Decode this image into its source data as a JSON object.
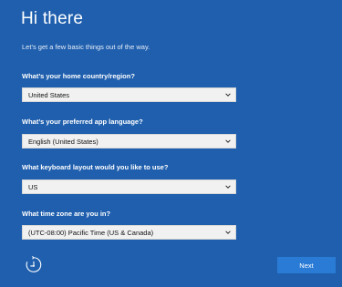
{
  "header": {
    "title": "Hi there",
    "subtitle": "Let’s get a few basic things out of the way."
  },
  "fields": [
    {
      "label": "What’s your home country/region?",
      "value": "United States"
    },
    {
      "label": "What’s your preferred app language?",
      "value": "English (United States)"
    },
    {
      "label": "What keyboard layout would you like to use?",
      "value": "US"
    },
    {
      "label": "What time zone are you in?",
      "value": "(UTC-08:00) Pacific Time (US & Canada)"
    }
  ],
  "footer": {
    "next_label": "Next",
    "accessibility_icon": "accessibility-icon"
  },
  "colors": {
    "background": "#1f5fae",
    "button": "#2a7bd6",
    "dropdown": "#f1f1f1"
  }
}
